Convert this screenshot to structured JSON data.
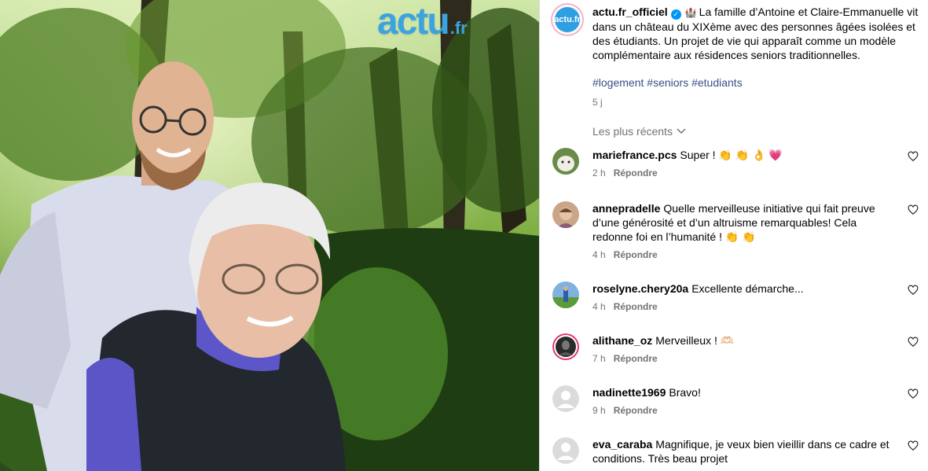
{
  "brand": {
    "name": "actu",
    "suffix": ".fr"
  },
  "post": {
    "username": "actu.fr_officiel",
    "avatar_text": "actu.fr",
    "verified_icon": "verified-badge-icon",
    "emoji_castle": "🏰",
    "caption": "La famille d’Antoine et Claire-Emmanuelle vit dans un château du XIXème avec des personnes âgées isolées et des étudiants. Un projet de vie qui apparaît comme un modèle complémentaire aux résidences seniors traditionnelles.",
    "hashtags": [
      "#logement",
      "#seniors",
      "#etudiants"
    ],
    "time": "5 j"
  },
  "sort": {
    "label": "Les plus récents",
    "icon": "chevron-down-icon"
  },
  "reply_label": "Répondre",
  "comments": [
    {
      "user": "mariefrance.pcs",
      "text": "Super ! 👏 👏 👌 💗",
      "time": "2 h"
    },
    {
      "user": "annepradelle",
      "text": "Quelle merveilleuse initiative qui fait preuve d’une générosité et d’un altruisme remarquables! Cela redonne foi en l’humanité ! 👏 👏",
      "time": "4 h"
    },
    {
      "user": "roselyne.chery20a",
      "text": "Excellente démarche...",
      "time": "4 h"
    },
    {
      "user": "alithane_oz",
      "text": "Merveilleux ! 🫶🏻",
      "time": "7 h"
    },
    {
      "user": "nadinette1969",
      "text": "Bravo!",
      "time": "9 h"
    },
    {
      "user": "eva_caraba",
      "text": "Magnifique, je veux bien vieillir dans ce cadre et conditions. Très beau projet",
      "time": ""
    }
  ]
}
